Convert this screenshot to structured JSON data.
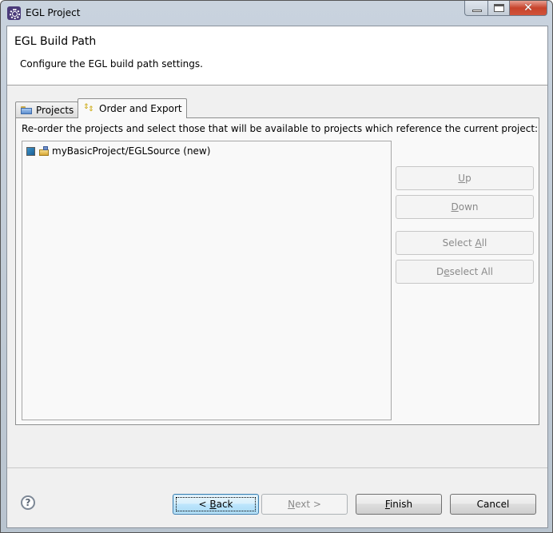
{
  "window": {
    "title": "EGL Project",
    "icon": "eclipse-gear-icon",
    "controls": {
      "minimize": "minimize-icon",
      "maximize": "maximize-icon",
      "close": "✕"
    }
  },
  "header": {
    "title": "EGL Build Path",
    "description": "Configure the EGL build path settings."
  },
  "tabs": [
    {
      "label": "Projects",
      "icon": "folder-icon",
      "selected": false
    },
    {
      "label": "Order and Export",
      "icon": "order-arrows-icon",
      "selected": true
    }
  ],
  "order_panel": {
    "description": "Re-order the projects and select those that will be available to projects which reference the current project:",
    "items": [
      {
        "label": "myBasicProject/EGLSource (new)",
        "checked": true,
        "icon": "project-folder-icon"
      }
    ],
    "buttons": {
      "up": {
        "pre": "",
        "mnemonic": "U",
        "post": "p",
        "enabled": false
      },
      "down": {
        "pre": "",
        "mnemonic": "D",
        "post": "own",
        "enabled": false
      },
      "select_all": {
        "pre": "Select ",
        "mnemonic": "A",
        "post": "ll",
        "enabled": false
      },
      "deselect_all": {
        "pre": "D",
        "mnemonic": "e",
        "post": "select All",
        "enabled": false
      }
    }
  },
  "footer": {
    "help": "?",
    "back": {
      "pre": "< ",
      "mnemonic": "B",
      "post": "ack"
    },
    "next": {
      "pre": "",
      "mnemonic": "N",
      "post": "ext >"
    },
    "finish": {
      "pre": "",
      "mnemonic": "F",
      "post": "inish"
    },
    "cancel": {
      "label": "Cancel"
    }
  }
}
